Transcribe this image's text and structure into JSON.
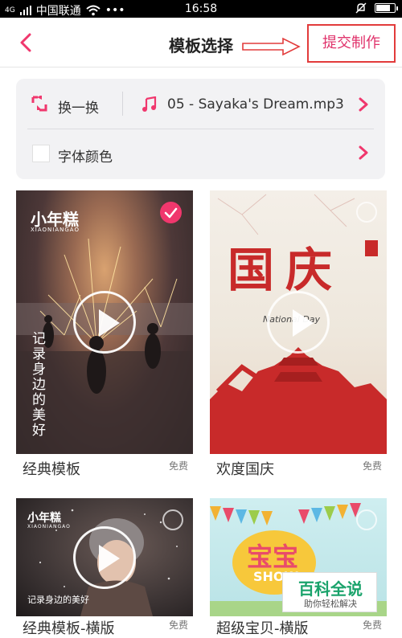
{
  "status_bar": {
    "carrier_signal": "4G",
    "carrier": "中国联通",
    "more": "•••",
    "time": "16:58"
  },
  "header": {
    "title": "模板选择",
    "submit_label": "提交制作"
  },
  "settings": {
    "shuffle_label": "换一换",
    "music_label": "05 - Sayaka's Dream.mp3",
    "font_color_label": "字体颜色"
  },
  "templates": [
    {
      "title": "经典模板",
      "badge": "免费",
      "selected": true,
      "logo": "小年糕",
      "logo_sub": "XIAONIANGAO",
      "overlay_text": "记录身边的美好"
    },
    {
      "title": "欢度国庆",
      "badge": "免费",
      "selected": false,
      "big_text": "国庆",
      "sub_text": "National Day"
    },
    {
      "title": "经典模板-横版",
      "badge": "免费",
      "selected": false,
      "logo": "小年糕",
      "logo_sub": "XIAONIANGAO",
      "overlay_text": "记录身边的美好"
    },
    {
      "title": "超级宝贝-横版",
      "badge": "免费",
      "selected": false,
      "big_text": "宝宝",
      "sub_text": "SHOW"
    }
  ],
  "watermark": {
    "top": "百科全说",
    "bottom": "助你轻松解决"
  },
  "colors": {
    "accent": "#f0376d",
    "panel_bg": "#f2f2f4",
    "annotation_red": "#e23b3b"
  },
  "icons": {
    "back": "chevron-left-icon",
    "shuffle": "shuffle-icon",
    "music": "music-note-icon",
    "chevron": "chevron-right-icon",
    "play": "play-icon",
    "check": "check-icon"
  }
}
